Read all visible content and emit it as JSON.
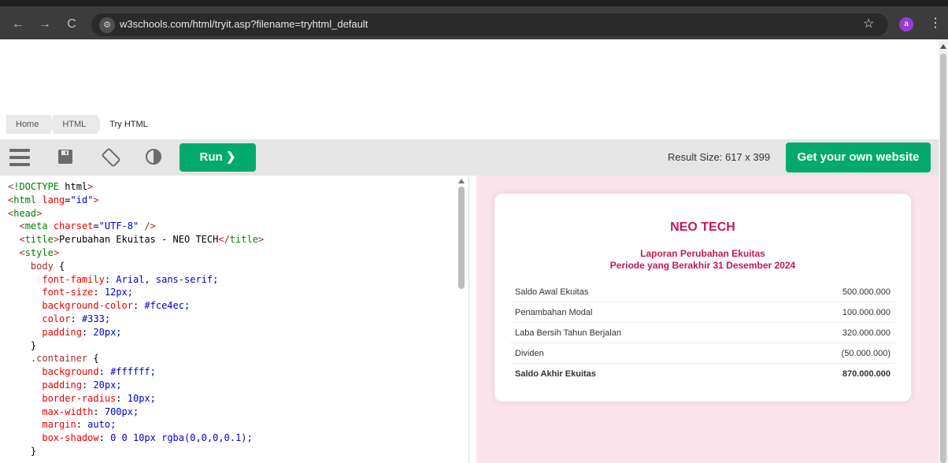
{
  "browser": {
    "url": "w3schools.com/html/tryit.asp?filename=tryhtml_default",
    "avatar_letter": "a",
    "back": "←",
    "forward": "→",
    "reload": "C"
  },
  "breadcrumb": [
    "Home",
    "HTML",
    "Try HTML"
  ],
  "toolbar": {
    "run_label": "Run ❯",
    "result_size": "Result Size: 617 x 399",
    "get_website_label": "Get your own website"
  },
  "code_lines": [
    "<!DOCTYPE html>",
    "<html lang=\"id\">",
    "<head>",
    "  <meta charset=\"UTF-8\" />",
    "  <title>Perubahan Ekuitas - NEO TECH</title>",
    "  <style>",
    "    body {",
    "      font-family: Arial, sans-serif;",
    "      font-size: 12px;",
    "      background-color: #fce4ec;",
    "      color: #333;",
    "      padding: 20px;",
    "    }",
    "    .container {",
    "      background: #ffffff;",
    "      padding: 20px;",
    "      border-radius: 10px;",
    "      max-width: 700px;",
    "      margin: auto;",
    "      box-shadow: 0 0 10px rgba(0,0,0,0.1);",
    "    }"
  ],
  "result": {
    "title": "NEO TECH",
    "subtitle1": "Laporan Perubahan Ekuitas",
    "subtitle2": "Periode yang Berakhir 31 Desember 2024",
    "rows": [
      {
        "label": "Saldo Awal Ekuitas",
        "value": "500.000.000"
      },
      {
        "label": "Penambahan Modal",
        "value": "100.000.000"
      },
      {
        "label": "Laba Bersih Tahun Berjalan",
        "value": "320.000.000"
      },
      {
        "label": "Dividen",
        "value": "(50.000.000)"
      },
      {
        "label": "Saldo Akhir Ekuitas",
        "value": "870.000.000"
      }
    ]
  },
  "colors": {
    "run_green": "#04aa6d",
    "result_bg": "#fce4ec",
    "title_pink": "#c2185b"
  }
}
